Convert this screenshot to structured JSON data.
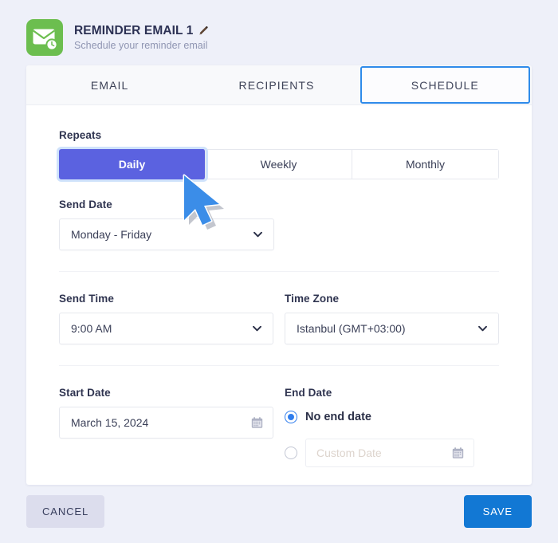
{
  "header": {
    "logo_icon": "envelope-clock-icon",
    "title": "REMINDER EMAIL 1",
    "edit_icon": "pencil-icon",
    "subtitle": "Schedule your reminder email",
    "brand_color": "#6cbe4f"
  },
  "tabs": [
    {
      "label": "EMAIL",
      "active": false
    },
    {
      "label": "RECIPIENTS",
      "active": false
    },
    {
      "label": "SCHEDULE",
      "active": true
    }
  ],
  "form": {
    "repeats": {
      "label": "Repeats",
      "options": [
        "Daily",
        "Weekly",
        "Monthly"
      ],
      "selected": "Daily",
      "selected_color": "#5b62e0"
    },
    "send_date": {
      "label": "Send Date",
      "value": "Monday - Friday",
      "chevron_icon": "chevron-down-icon"
    },
    "send_time": {
      "label": "Send Time",
      "value": "9:00 AM",
      "chevron_icon": "chevron-down-icon"
    },
    "time_zone": {
      "label": "Time Zone",
      "value": "Istanbul (GMT+03:00)",
      "chevron_icon": "chevron-down-icon"
    },
    "start_date": {
      "label": "Start Date",
      "value": "March 15, 2024",
      "calendar_icon": "calendar-icon"
    },
    "end_date": {
      "label": "End Date",
      "no_end_date_label": "No end date",
      "no_end_date_selected": true,
      "custom_date_placeholder": "Custom Date",
      "custom_date_value": "",
      "custom_date_selected": false,
      "calendar_icon": "calendar-icon",
      "radio_color": "#2f7ded"
    }
  },
  "footer": {
    "cancel_label": "CANCEL",
    "save_label": "SAVE",
    "save_color": "#1278d4"
  },
  "cursor": {
    "icon": "mouse-pointer-arrow"
  }
}
